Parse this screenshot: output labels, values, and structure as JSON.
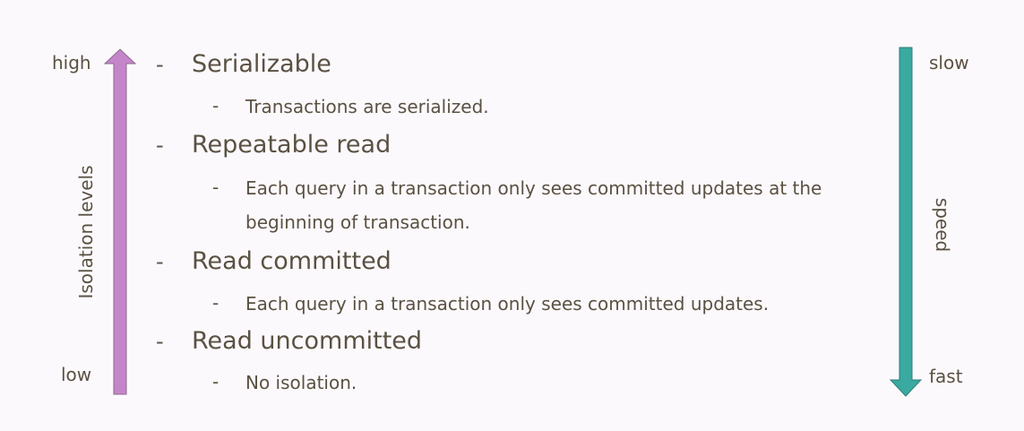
{
  "left_axis": {
    "top_label": "high",
    "bottom_label": "low",
    "axis_title": "Isolation levels",
    "color": "#c585cb"
  },
  "right_axis": {
    "top_label": "slow",
    "bottom_label": "fast",
    "axis_title": "speed",
    "color": "#3aa9a0"
  },
  "bullet": "-",
  "levels": [
    {
      "title": "Serializable",
      "description": [
        "Transactions are serialized."
      ]
    },
    {
      "title": "Repeatable read",
      "description": [
        "Each query in a transaction only sees committed updates at the",
        "beginning of transaction."
      ]
    },
    {
      "title": "Read committed",
      "description": [
        "Each query in a transaction only sees committed updates."
      ]
    },
    {
      "title": "Read uncommitted",
      "description": [
        "No isolation."
      ]
    }
  ]
}
